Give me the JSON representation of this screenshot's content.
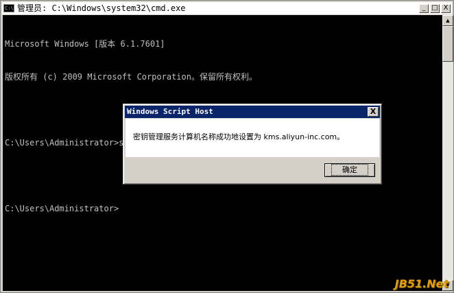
{
  "window": {
    "title": "管理员: C:\\Windows\\system32\\cmd.exe",
    "minimize_label": "_",
    "maximize_label": "□",
    "close_label": "X"
  },
  "console": {
    "lines": [
      "Microsoft Windows [版本 6.1.7601]",
      "版权所有 (c) 2009 Microsoft Corporation。保留所有权利。",
      "",
      "C:\\Users\\Administrator>slmgr -skms kms.aliyun-inc.com",
      "",
      "C:\\Users\\Administrator>"
    ]
  },
  "scrollbar": {
    "up_arrow": "▲",
    "down_arrow": "▼"
  },
  "dialog": {
    "title": "Windows Script Host",
    "close_label": "X",
    "message": "密钥管理服务计算机名称成功地设置为 kms.aliyun-inc.com。",
    "ok_label": "确定"
  },
  "watermark": {
    "text": "JB51.Net"
  },
  "colors": {
    "console_bg": "#000000",
    "console_text": "#c0c0c0",
    "dialog_title_bg": "#0a246a",
    "window_chrome": "#d4d0c8"
  }
}
